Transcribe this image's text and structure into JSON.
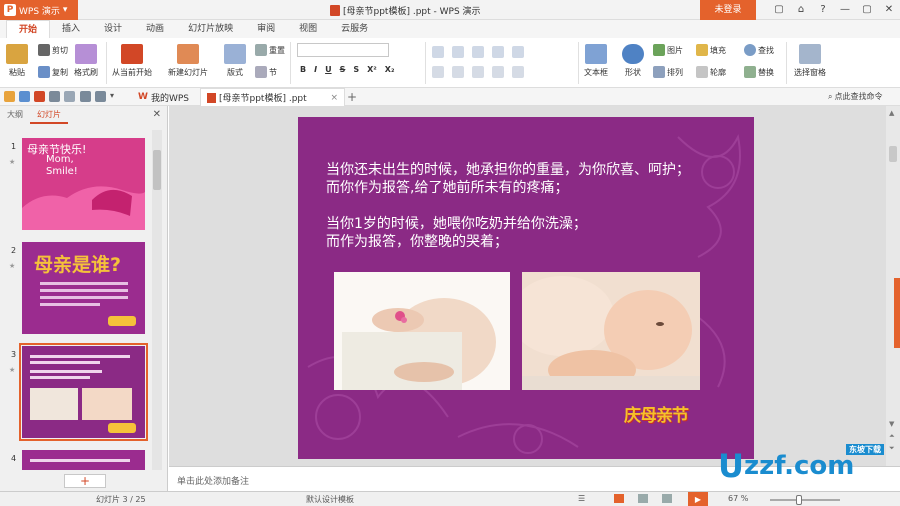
{
  "titlebar": {
    "app_name": "WPS 演示",
    "doc_title": "[母亲节ppt模板] .ppt - WPS 演示",
    "login": "未登录",
    "controls": [
      "▢",
      "⌂",
      "?",
      "—",
      "▢",
      "✕"
    ]
  },
  "ribbon_tabs": [
    "开始",
    "插入",
    "设计",
    "动画",
    "幻灯片放映",
    "审阅",
    "视图",
    "云服务"
  ],
  "active_tab": "开始",
  "ribbon": {
    "paste": "粘贴",
    "cut": "剪切",
    "copy": "复制",
    "format_painter": "格式刷",
    "from_current": "从当前开始",
    "new_slide": "新建幻灯片",
    "layout": "版式",
    "section": "节",
    "reset": "重置",
    "text_box": "文本框",
    "shape": "形状",
    "arrange": "排列",
    "picture": "图片",
    "fill": "填充",
    "outline": "轮廓",
    "find": "查找",
    "replace": "替换",
    "select_pane": "选择窗格",
    "bold": "B",
    "italic": "I",
    "underline": "U",
    "strike": "S",
    "shadow": "S",
    "superscript": "X²",
    "subscript": "X₂"
  },
  "doc_tabs": {
    "my_wps": "我的WPS",
    "current_doc": "[母亲节ppt模板] .ppt",
    "new_tab": "+",
    "search_command": "点此查找命令"
  },
  "left_pane": {
    "tab_outline": "大纲",
    "tab_slides": "幻灯片",
    "slides": [
      {
        "num": "1",
        "title": "母亲节快乐!",
        "line1": "Mom,",
        "line2": "Smile!"
      },
      {
        "num": "2",
        "title": "母亲是谁?"
      },
      {
        "num": "3"
      },
      {
        "num": "4"
      }
    ],
    "add": "+"
  },
  "slide": {
    "lines": [
      "当你还未出生的时候，她承担你的重量，为你欣喜、呵护；",
      "而你作为报答,给了她前所未有的疼痛；",
      "",
      "当你1岁的时候，她喂你吃奶并给你洗澡；",
      "而作为报答，你整晚的哭着；"
    ],
    "logo_text": "庆母亲节"
  },
  "notes_placeholder": "单击此处添加备注",
  "statusbar": {
    "slide_info": "幻灯片 3 / 25",
    "theme": "默认设计模板",
    "zoom": "67 %"
  },
  "watermark": {
    "u": "U",
    "domain": "zzf.com",
    "label": "东坡下载"
  },
  "colors": {
    "accent": "#e4622c",
    "slide_bg": "#8b2a85",
    "thumb1_bg": "#d63d8a"
  }
}
